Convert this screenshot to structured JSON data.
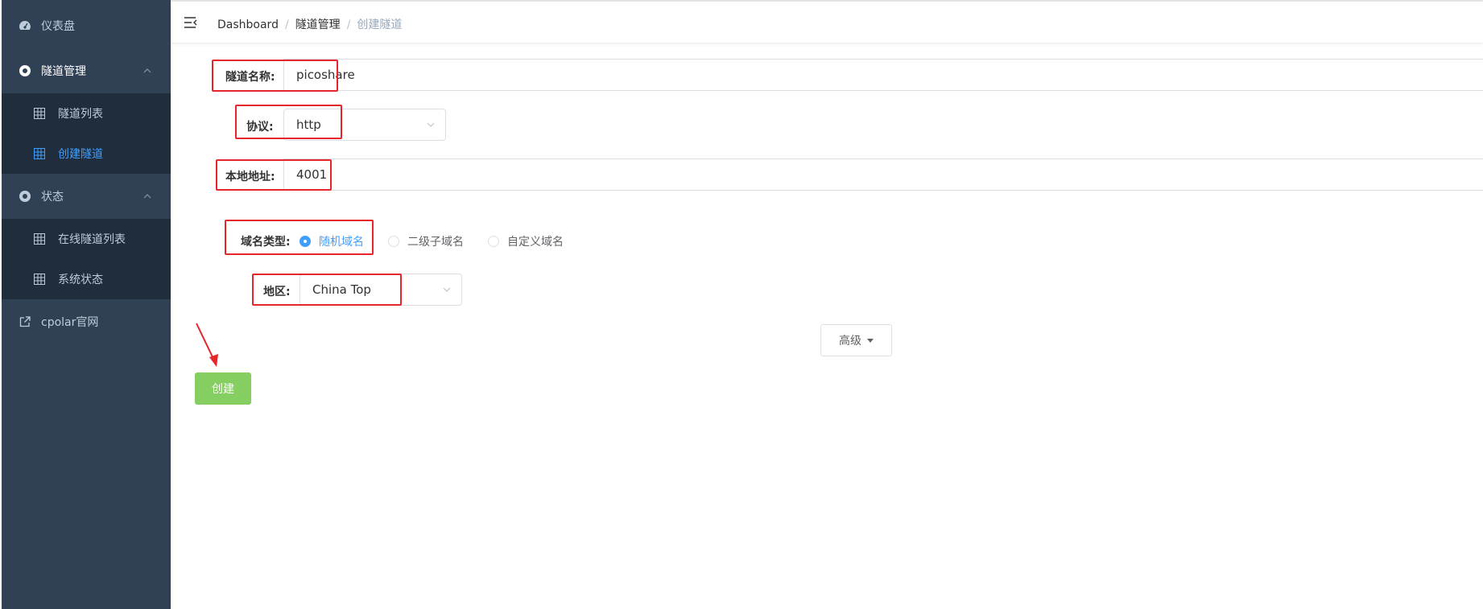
{
  "sidebar": {
    "items": [
      {
        "label": "仪表盘",
        "icon": "dashboard-icon"
      },
      {
        "label": "隧道管理",
        "icon": "tunnel-manage-icon"
      },
      {
        "label": "状态",
        "icon": "status-icon"
      },
      {
        "label": "cpolar官网",
        "icon": "external-link-icon"
      }
    ],
    "tunnel_sub": [
      {
        "label": "隧道列表",
        "icon": "table-icon"
      },
      {
        "label": "创建隧道",
        "icon": "table-icon",
        "active": true
      }
    ],
    "status_sub": [
      {
        "label": "在线隧道列表",
        "icon": "table-icon"
      },
      {
        "label": "系统状态",
        "icon": "table-icon"
      }
    ]
  },
  "breadcrumb": {
    "items": [
      "Dashboard",
      "隧道管理",
      "创建隧道"
    ],
    "separator": "/"
  },
  "form": {
    "tunnel_name": {
      "label": "隧道名称:",
      "value": "picoshare"
    },
    "protocol": {
      "label": "协议:",
      "value": "http"
    },
    "local_address": {
      "label": "本地地址:",
      "value": "4001"
    },
    "domain_type": {
      "label": "域名类型:",
      "options": [
        "随机域名",
        "二级子域名",
        "自定义域名"
      ],
      "selected": "随机域名"
    },
    "region": {
      "label": "地区:",
      "value": "China Top"
    }
  },
  "buttons": {
    "advanced": "高级",
    "create": "创建"
  },
  "colors": {
    "sidebar_bg": "#304156",
    "submenu_bg": "#1f2d3d",
    "active": "#409eff",
    "create_button": "#85ce61",
    "annotation_red": "#e6262b"
  }
}
